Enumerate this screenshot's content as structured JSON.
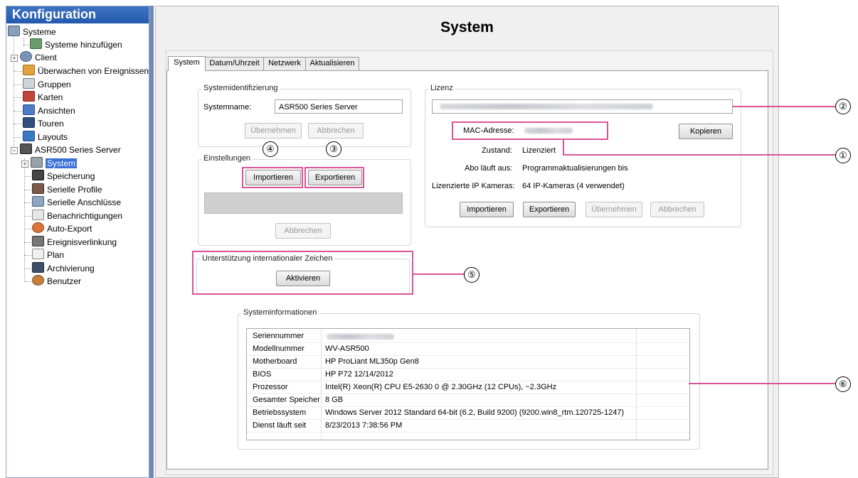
{
  "sidebar": {
    "title": "Konfiguration",
    "items": [
      {
        "label": "Systeme"
      },
      {
        "label": "Systeme hinzufügen"
      },
      {
        "label": "Client"
      },
      {
        "label": "Überwachen von Ereignissen"
      },
      {
        "label": "Gruppen"
      },
      {
        "label": "Karten"
      },
      {
        "label": "Ansichten"
      },
      {
        "label": "Touren"
      },
      {
        "label": "Layouts"
      },
      {
        "label": "ASR500 Series Server"
      },
      {
        "label": "System"
      },
      {
        "label": "Speicherung"
      },
      {
        "label": "Serielle Profile"
      },
      {
        "label": "Serielle Anschlüsse"
      },
      {
        "label": "Benachrichtigungen"
      },
      {
        "label": "Auto-Export"
      },
      {
        "label": "Ereignisverlinkung"
      },
      {
        "label": "Plan"
      },
      {
        "label": "Archivierung"
      },
      {
        "label": "Benutzer"
      }
    ]
  },
  "main": {
    "title": "System",
    "tabs": [
      {
        "label": "System"
      },
      {
        "label": "Datum/Uhrzeit"
      },
      {
        "label": "Netzwerk"
      },
      {
        "label": "Aktualisieren"
      }
    ],
    "system_id": {
      "group_title": "Systemidentifizierung",
      "name_label": "Systemname:",
      "name_value": "ASR500 Series Server",
      "apply": "Übernehmen",
      "cancel": "Abbrechen"
    },
    "settings": {
      "group_title": "Einstellungen",
      "import": "Importieren",
      "export": "Exportieren",
      "cancel": "Abbrechen"
    },
    "intl": {
      "group_title": "Unterstützung internationaler Zeichen",
      "activate": "Aktivieren"
    },
    "license": {
      "group_title": "Lizenz",
      "mac_label": "MAC-Adresse:",
      "copy": "Kopieren",
      "status_label": "Zustand:",
      "status_value": "Lizenziert",
      "subscription_label": "Abo läuft aus:",
      "subscription_value": "Programmaktualisierungen bis",
      "cameras_label": "Lizenzierte IP Kameras:",
      "cameras_value": "64 IP-Kameras (4 verwendet)",
      "import": "Importieren",
      "export": "Exportieren",
      "apply": "Übernehmen",
      "cancel": "Abbrechen"
    },
    "sysinfo": {
      "group_title": "Systeminformationen",
      "rows": [
        {
          "key": "Seriennummer",
          "value": ""
        },
        {
          "key": "Modellnummer",
          "value": "WV-ASR500"
        },
        {
          "key": "Motherboard",
          "value": "HP ProLiant ML350p Gen8"
        },
        {
          "key": "BIOS",
          "value": "HP P72 12/14/2012"
        },
        {
          "key": "Prozessor",
          "value": "Intel(R) Xeon(R) CPU E5-2630 0 @ 2.30GHz (12 CPUs), ~2.3GHz"
        },
        {
          "key": "Gesamter Speicher",
          "value": "8 GB"
        },
        {
          "key": "Betriebssystem",
          "value": "Windows Server 2012 Standard 64-bit (6.2, Build 9200) (9200.win8_rtm.120725-1247)"
        },
        {
          "key": "Dienst läuft seit",
          "value": "8/23/2013 7:38:56 PM"
        }
      ]
    }
  },
  "callouts": {
    "c1": "①",
    "c2": "②",
    "c3": "③",
    "c4": "④",
    "c5": "⑤",
    "c6": "⑥"
  },
  "colors": {
    "annotation": "#d9539a",
    "sidebar_header": "#2d62b8",
    "selection": "#3a6fd8"
  }
}
